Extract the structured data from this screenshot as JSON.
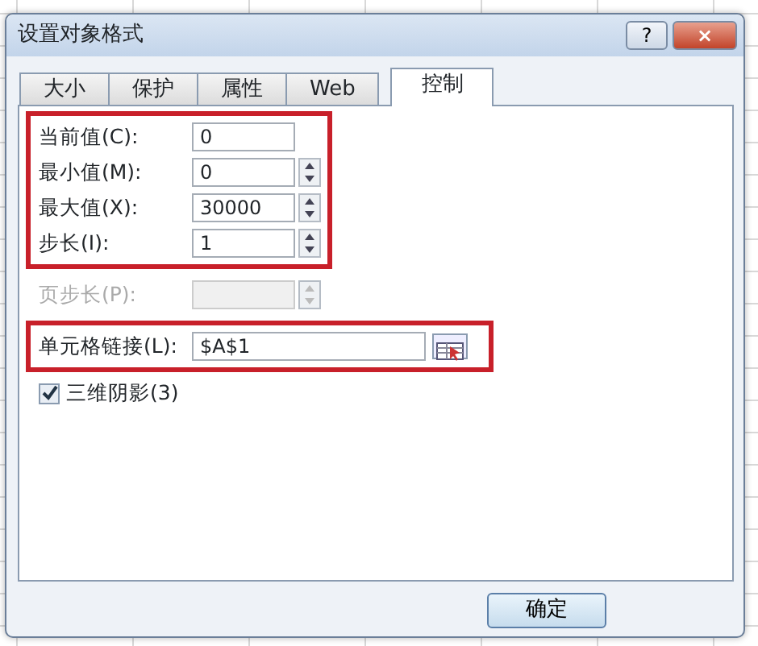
{
  "window": {
    "title": "设置对象格式",
    "help": "?",
    "close": "×"
  },
  "tabs": [
    {
      "label": "大小",
      "selected": false
    },
    {
      "label": "保护",
      "selected": false
    },
    {
      "label": "属性",
      "selected": false
    },
    {
      "label": "Web",
      "selected": false
    },
    {
      "label": "控制",
      "selected": true
    }
  ],
  "groups": [
    {
      "highlighted": true,
      "fields": [
        {
          "label": "当前值(C):",
          "kind": "text",
          "value": "0",
          "disabled": false
        },
        {
          "label": "最小值(M):",
          "kind": "spin",
          "value": "0",
          "disabled": false
        },
        {
          "label": "最大值(X):",
          "kind": "spin",
          "value": "30000",
          "disabled": false
        },
        {
          "label": "步长(I):",
          "kind": "spin",
          "value": "1",
          "disabled": false
        }
      ]
    },
    {
      "highlighted": false,
      "fields": [
        {
          "label": "页步长(P):",
          "kind": "spin",
          "disabled": true
        }
      ]
    },
    {
      "highlighted": true,
      "fields": [
        {
          "label": "单元格链接(L):",
          "kind": "ref",
          "value": "$A$1",
          "disabled": false
        }
      ]
    }
  ],
  "checkbox": {
    "label": "三维阴影(3)",
    "checked": true
  },
  "buttons": [
    {
      "label": "确定"
    }
  ]
}
